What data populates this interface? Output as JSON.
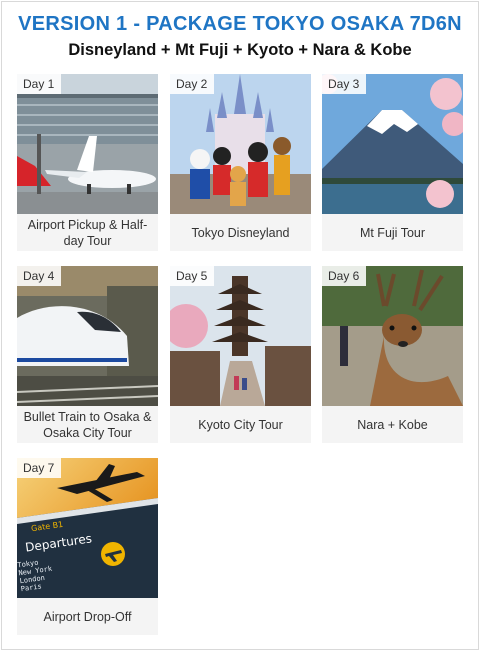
{
  "header": {
    "title": "VERSION 1 - PACKAGE TOKYO OSAKA 7D6N",
    "subtitle": "Disneyland + Mt Fuji + Kyoto + Nara & Kobe"
  },
  "days": [
    {
      "day": "Day 1",
      "title": "Airport Pickup & Half-day Tour",
      "image": "airport-airplane-photo"
    },
    {
      "day": "Day 2",
      "title": "Tokyo Disneyland",
      "image": "disney-castle-characters-photo"
    },
    {
      "day": "Day 3",
      "title": "Mt Fuji Tour",
      "image": "mt-fuji-cherry-blossom-photo"
    },
    {
      "day": "Day 4",
      "title": "Bullet Train to Osaka & Osaka City Tour",
      "image": "shinkansen-photo"
    },
    {
      "day": "Day 5",
      "title": "Kyoto City Tour",
      "image": "kyoto-pagoda-photo"
    },
    {
      "day": "Day 6",
      "title": "Nara + Kobe",
      "image": "nara-deer-photo"
    },
    {
      "day": "Day 7",
      "title": "Airport Drop-Off",
      "image": "departures-board-photo"
    }
  ],
  "departures_sign": {
    "gate": "Gate B1",
    "heading": "Departures",
    "cities": [
      "Tokyo",
      "New York",
      "London",
      "Paris"
    ]
  },
  "colors": {
    "title": "#1f75c4",
    "card_bg": "#f4f4f4"
  }
}
